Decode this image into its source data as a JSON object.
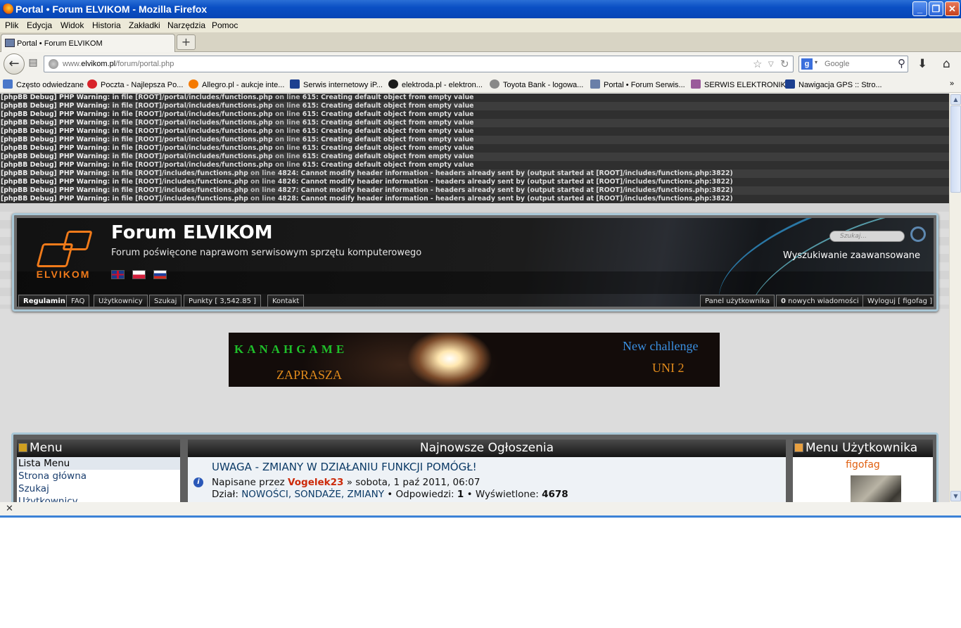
{
  "window": {
    "title": "Portal • Forum ELVIKOM - Mozilla Firefox"
  },
  "menubar": [
    "Plik",
    "Edycja",
    "Widok",
    "Historia",
    "Zakładki",
    "Narzędzia",
    "Pomoc"
  ],
  "tab": {
    "label": "Portal • Forum ELVIKOM"
  },
  "url": {
    "prefix": "www.",
    "domain": "elvikom.pl",
    "path": "/forum/portal.php"
  },
  "search": {
    "engine_letter": "g",
    "placeholder": "Google"
  },
  "bookmarks": [
    {
      "label": "Często odwiedzane",
      "icon": "bookmark-folder-icon",
      "color": "#4a77c9"
    },
    {
      "label": "Poczta - Najlepsza Po...",
      "icon": "ladybug-icon",
      "color": "#d8232a"
    },
    {
      "label": "Allegro.pl - aukcje inte...",
      "icon": "allegro-icon",
      "color": "#f57a00"
    },
    {
      "label": "Serwis internetowy iP...",
      "icon": "bank-icon",
      "color": "#1c3f8f"
    },
    {
      "label": "elektroda.pl - elektron...",
      "icon": "ie-icon",
      "color": "#1b1b1b"
    },
    {
      "label": "Toyota Bank - logowa...",
      "icon": "toyota-icon",
      "color": "#888888"
    },
    {
      "label": "Portal • Forum Serwis...",
      "icon": "laptop-icon",
      "color": "#6a7fa8"
    },
    {
      "label": "SERWIS ELEKTRONIKI",
      "icon": "calendar-icon",
      "color": "#9a5a9a"
    },
    {
      "label": "Nawigacja GPS :: Stro...",
      "icon": "gps-icon",
      "color": "#1c3f8f"
    }
  ],
  "debug": {
    "prefix": "[phpBB Debug] PHP Warning",
    "lines": [
      {
        "file": ": in file [ROOT]/portal/includes/functions.php",
        "mid": " on line ",
        "rest": "615: Creating default object from empty value"
      },
      {
        "file": ": in file [ROOT]/portal/includes/functions.php",
        "mid": " on line ",
        "rest": "615: Creating default object from empty value"
      },
      {
        "file": ": in file [ROOT]/portal/includes/functions.php",
        "mid": " on line ",
        "rest": "615: Creating default object from empty value"
      },
      {
        "file": ": in file [ROOT]/portal/includes/functions.php",
        "mid": " on line ",
        "rest": "615: Creating default object from empty value"
      },
      {
        "file": ": in file [ROOT]/portal/includes/functions.php",
        "mid": " on line ",
        "rest": "615: Creating default object from empty value"
      },
      {
        "file": ": in file [ROOT]/portal/includes/functions.php",
        "mid": " on line ",
        "rest": "615: Creating default object from empty value"
      },
      {
        "file": ": in file [ROOT]/portal/includes/functions.php",
        "mid": " on line ",
        "rest": "615: Creating default object from empty value"
      },
      {
        "file": ": in file [ROOT]/portal/includes/functions.php",
        "mid": " on line ",
        "rest": "615: Creating default object from empty value"
      },
      {
        "file": ": in file [ROOT]/portal/includes/functions.php",
        "mid": " on line ",
        "rest": "615: Creating default object from empty value"
      },
      {
        "file": ": in file [ROOT]/includes/functions.php",
        "mid": " on line ",
        "rest": "4824: Cannot modify header information - headers already sent by (output started at [ROOT]/includes/functions.php:3822)"
      },
      {
        "file": ": in file [ROOT]/includes/functions.php",
        "mid": " on line ",
        "rest": "4826: Cannot modify header information - headers already sent by (output started at [ROOT]/includes/functions.php:3822)"
      },
      {
        "file": ": in file [ROOT]/includes/functions.php",
        "mid": " on line ",
        "rest": "4827: Cannot modify header information - headers already sent by (output started at [ROOT]/includes/functions.php:3822)"
      },
      {
        "file": ": in file [ROOT]/includes/functions.php",
        "mid": " on line ",
        "rest": "4828: Cannot modify header information - headers already sent by (output started at [ROOT]/includes/functions.php:3822)"
      }
    ]
  },
  "forum": {
    "logo_text": "ELVIKOM",
    "title": "Forum ELVIKOM",
    "subtitle": "Forum poświęcone naprawom serwisowym sprzętu komputerowego",
    "search_placeholder": "Szukaj...",
    "advanced_search": "Wyszukiwanie zaawansowane",
    "nav_left": [
      "Regulamin",
      "FAQ",
      "Użytkownicy",
      "Szukaj",
      "Punkty  [ 3,542.85 ]",
      "Kontakt"
    ],
    "nav_right": {
      "panel": "Panel użytkownika",
      "new_count": "0",
      "new_messages": " nowych wiadomości",
      "logout": "Wyloguj [ figofag ]"
    }
  },
  "banner": {
    "left": "KANAHGAME",
    "left_sub": "ZAPRASZA",
    "right": "New challenge",
    "right_sub": "UNI 2"
  },
  "menu": {
    "title": "Menu",
    "items": [
      "Lista Menu",
      "Strona główna",
      "Szukaj",
      "Użytkownicy"
    ]
  },
  "announcements": {
    "title": "Najnowsze Ogłoszenia",
    "post_title": "UWAGA - ZMIANY W DZIAŁANIU FUNKCJI POMÓGŁ!",
    "posted_by": "Napisane przez ",
    "author": "Vogelek23",
    "date": " » sobota, 1 paź 2011, 06:07",
    "section_label": "Dział: ",
    "section": "NOWOŚCI, SONDAŻE, ZMIANY",
    "replies_label": " • Odpowiedzi: ",
    "replies": "1",
    "views_label": " • Wyświetlone: ",
    "views": "4678"
  },
  "user_menu": {
    "title": "Menu Użytkownika",
    "username": "figofag"
  }
}
